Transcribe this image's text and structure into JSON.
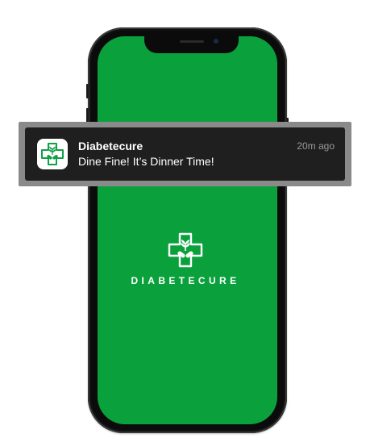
{
  "notification": {
    "app_name": "Diabetecure",
    "time": "20m ago",
    "message": "Dine Fine! It’s Dinner Time!",
    "app_icon": "diabetecure-logo-icon"
  },
  "splash": {
    "logo": "diabetecure-cross-leaf-logo",
    "title": "DIABETECURE"
  },
  "colors": {
    "brand_green": "#0aa13d",
    "notification_bg": "#1f1f1f",
    "notification_frame": "#8a8a8a"
  }
}
